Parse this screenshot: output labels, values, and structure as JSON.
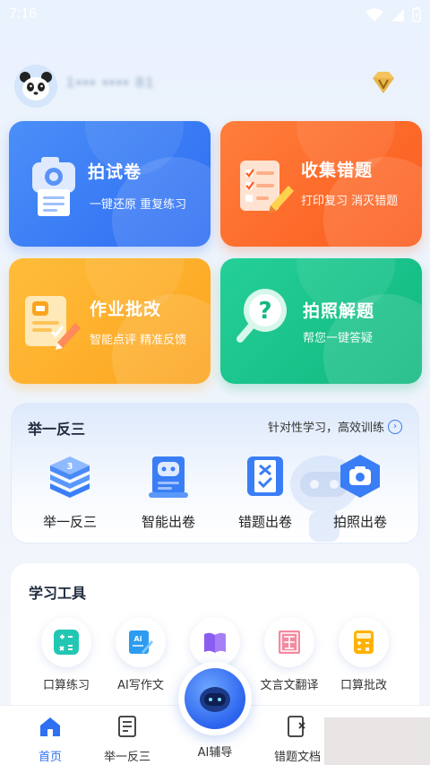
{
  "status_bar": {
    "time": "7:16"
  },
  "user": {
    "username": "1▪▪▪ ▪▪▪▪ 81"
  },
  "cards": [
    {
      "title": "拍试卷",
      "subtitle": "一键还原  重复练习",
      "icon": "camera-paper-icon",
      "color": "#3a7ef6"
    },
    {
      "title": "收集错题",
      "subtitle": "打印复习  消灭错题",
      "icon": "checklist-icon",
      "color": "#fc6a28"
    },
    {
      "title": "作业批改",
      "subtitle": "智能点评  精准反馈",
      "icon": "homework-correct-icon",
      "color": "#fdb02e"
    },
    {
      "title": "拍照解题",
      "subtitle": "帮您一键答疑",
      "icon": "magnifier-question-icon",
      "color": "#1cc58c"
    }
  ],
  "practice_section": {
    "title": "举一反三",
    "link": "针对性学习，高效训练",
    "items": [
      {
        "label": "举一反三",
        "icon": "stack-3-icon"
      },
      {
        "label": "智能出卷",
        "icon": "robot-paper-icon"
      },
      {
        "label": "错题出卷",
        "icon": "wrong-paper-icon"
      },
      {
        "label": "拍照出卷",
        "icon": "camera-icon"
      }
    ]
  },
  "tools_section": {
    "title": "学习工具",
    "items": [
      {
        "label": "口算练习",
        "icon": "calc-grid-icon"
      },
      {
        "label": "AI写作文",
        "icon": "ai-write-icon"
      },
      {
        "label": "",
        "icon": "book-icon"
      },
      {
        "label": "文言文翻译",
        "icon": "classical-text-icon"
      },
      {
        "label": "口算批改",
        "icon": "calculator-icon"
      }
    ]
  },
  "bottom_nav": {
    "items": [
      {
        "label": "首页",
        "icon": "home-icon",
        "active": true
      },
      {
        "label": "举一反三",
        "icon": "list-doc-icon",
        "active": false
      },
      {
        "label": "AI辅导",
        "icon": "ai-robot-icon",
        "active": false
      },
      {
        "label": "错题文档",
        "icon": "wrong-doc-icon",
        "active": false
      }
    ]
  },
  "colors": {
    "primary": "#2f6ff2",
    "text": "#222222"
  }
}
